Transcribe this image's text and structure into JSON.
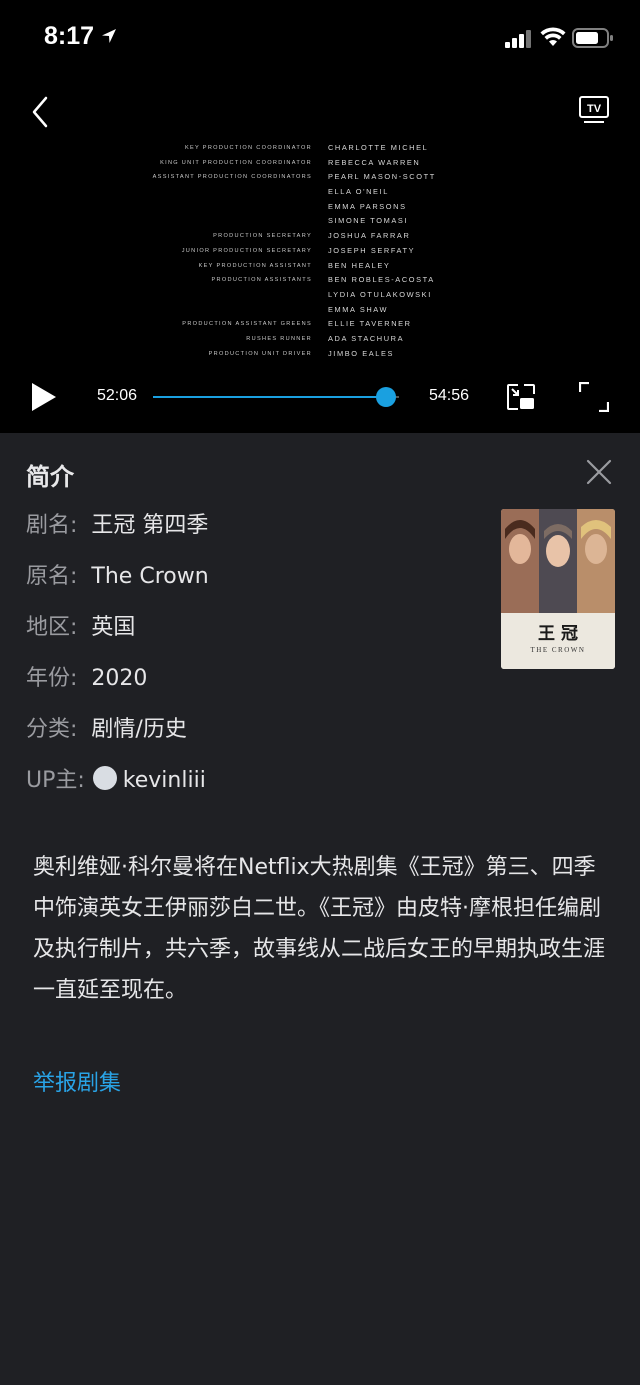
{
  "status_bar": {
    "time": "8:17"
  },
  "player": {
    "current_time": "52:06",
    "total_time": "54:56",
    "progress": 0.946,
    "credits": [
      {
        "role": "KEY PRODUCTION COORDINATOR",
        "name": "CHARLOTTE MICHEL"
      },
      {
        "role": "KING UNIT PRODUCTION COORDINATOR",
        "name": "REBECCA WARREN"
      },
      {
        "role": "ASSISTANT PRODUCTION COORDINATORS",
        "name": "PEARL MASON-SCOTT"
      },
      {
        "role": "",
        "name": "ELLA O'NEIL"
      },
      {
        "role": "",
        "name": "EMMA PARSONS"
      },
      {
        "role": "",
        "name": "SIMONE TOMASI"
      },
      {
        "role": "PRODUCTION SECRETARY",
        "name": "JOSHUA FARRAR"
      },
      {
        "role": "JUNIOR PRODUCTION SECRETARY",
        "name": "JOSEPH SERFATY"
      },
      {
        "role": "KEY PRODUCTION ASSISTANT",
        "name": "BEN HEALEY"
      },
      {
        "role": "PRODUCTION ASSISTANTS",
        "name": "BEN ROBLES-ACOSTA"
      },
      {
        "role": "",
        "name": "LYDIA OTULAKOWSKI"
      },
      {
        "role": "",
        "name": "EMMA SHAW"
      },
      {
        "role": "PRODUCTION ASSISTANT GREENS",
        "name": "ELLIE TAVERNER"
      },
      {
        "role": "RUSHES RUNNER",
        "name": "ADA STACHURA"
      },
      {
        "role": "PRODUCTION UNIT DRIVER",
        "name": "JIMBO EALES"
      }
    ]
  },
  "info": {
    "title": "简介",
    "rows": [
      {
        "key": "剧名:",
        "value": "王冠 第四季"
      },
      {
        "key": "原名:",
        "value": "The Crown"
      },
      {
        "key": "地区:",
        "value": "英国"
      },
      {
        "key": "年份:",
        "value": "2020"
      },
      {
        "key": "分类:",
        "value": "剧情/历史"
      }
    ],
    "uploader_key": "UP主:",
    "uploader_name": "kevinliii",
    "poster": {
      "title_cn": "王 冠",
      "title_en": "THE CROWN"
    },
    "description": "奥利维娅·科尔曼将在Netflix大热剧集《王冠》第三、四季中饰演英女王伊丽莎白二世。《王冠》由皮特·摩根担任编剧及执行制片，共六季，故事线从二战后女王的早期执政生涯一直延至现在。",
    "report_link": "举报剧集"
  },
  "colors": {
    "accent": "#1aa0e0",
    "link": "#29a3e6",
    "panel_bg": "#1f2024"
  }
}
